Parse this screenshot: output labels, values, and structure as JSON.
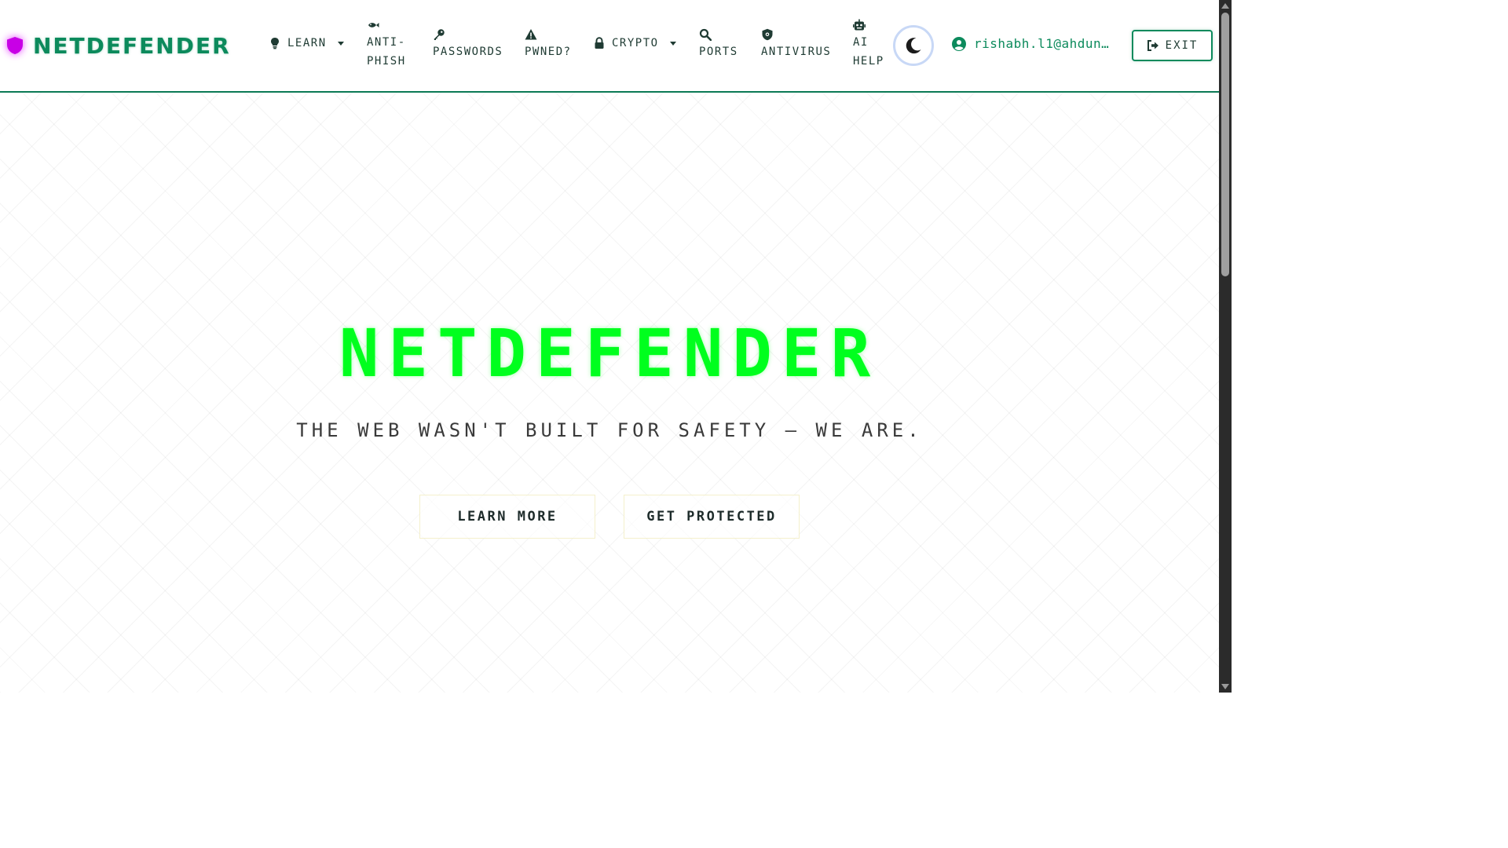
{
  "brand": {
    "name": "NETDEFENDER",
    "icon": "shield-icon",
    "glow_color": "#d900ff"
  },
  "nav": {
    "learn": {
      "label": "LEARN",
      "icon": "lightbulb-icon"
    },
    "antiphish": {
      "line1": "ANTI-",
      "line2": "PHISH",
      "icon": "fish-icon"
    },
    "passwords": {
      "label": "PASSWORDS",
      "icon": "key-icon"
    },
    "pwned": {
      "label": "PWNED?",
      "icon": "warning-icon"
    },
    "crypto": {
      "label": "CRYPTO",
      "icon": "lock-icon"
    },
    "ports": {
      "label": "PORTS",
      "icon": "search-icon"
    },
    "antivirus": {
      "label": "ANTIVIRUS",
      "icon": "shield-virus-icon"
    },
    "ai_help": {
      "line1": "AI",
      "line2": "HELP",
      "icon": "robot-icon"
    }
  },
  "theme_toggle": {
    "icon": "moon-icon"
  },
  "user": {
    "email": "rishabh.l1@ahdun…",
    "icon": "user-circle-icon"
  },
  "exit": {
    "label": "EXIT",
    "icon": "sign-out-icon"
  },
  "hero": {
    "title": "NETDEFENDER",
    "subtitle": "THE WEB WASN'T BUILT FOR SAFETY — WE ARE.",
    "learn_more": "LEARN MORE",
    "get_protected": "GET PROTECTED"
  },
  "colors": {
    "accent": "#0c8a5c",
    "hero_title": "#00ff1e",
    "brand_glow": "#d900ff"
  }
}
